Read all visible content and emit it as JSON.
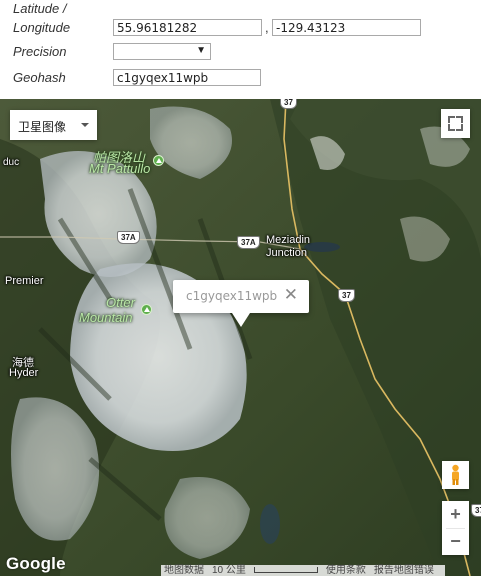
{
  "form": {
    "latlng_label_line1": "Latitude /",
    "latlng_label_line2": "Longitude",
    "latitude_value": "55.96181282",
    "separator": ",",
    "longitude_value": "-129.43123",
    "precision_label": "Precision",
    "precision_value": "",
    "geohash_label": "Geohash",
    "geohash_value": "c1gyqex11wpb"
  },
  "map": {
    "map_type_label": "卫星图像",
    "infowindow_text": "c1gyqex11wpb",
    "close_glyph": "✕",
    "zoom_in": "+",
    "zoom_out": "−",
    "logo": "Google",
    "places": {
      "mt_pattullo_cn": "帕图洛山",
      "mt_pattullo_en": "Mt Pattullo",
      "meziadin_line1": "Meziadin",
      "meziadin_line2": "Junction",
      "otter_line1": "Otter",
      "otter_line2": "Mountain",
      "premier": "Premier",
      "hyder_cn": "海德",
      "hyder_en": "Hyder",
      "duc": "duc"
    },
    "shields": {
      "hwy37_top": "37",
      "hwy37a_left": "37A",
      "hwy37a_right": "37A",
      "hwy37_mid": "37",
      "hwy37_edge": "37"
    },
    "attribution": {
      "data": "地图数据",
      "scale": "10 公里",
      "terms": "使用条款",
      "report": "报告地图错误"
    }
  },
  "colors": {
    "forest": "#3c4a2c",
    "snow": "#e8ecef",
    "road": "#d9b860",
    "peak_green": "#5fae4d",
    "pegman_orange": "#f5a623"
  }
}
